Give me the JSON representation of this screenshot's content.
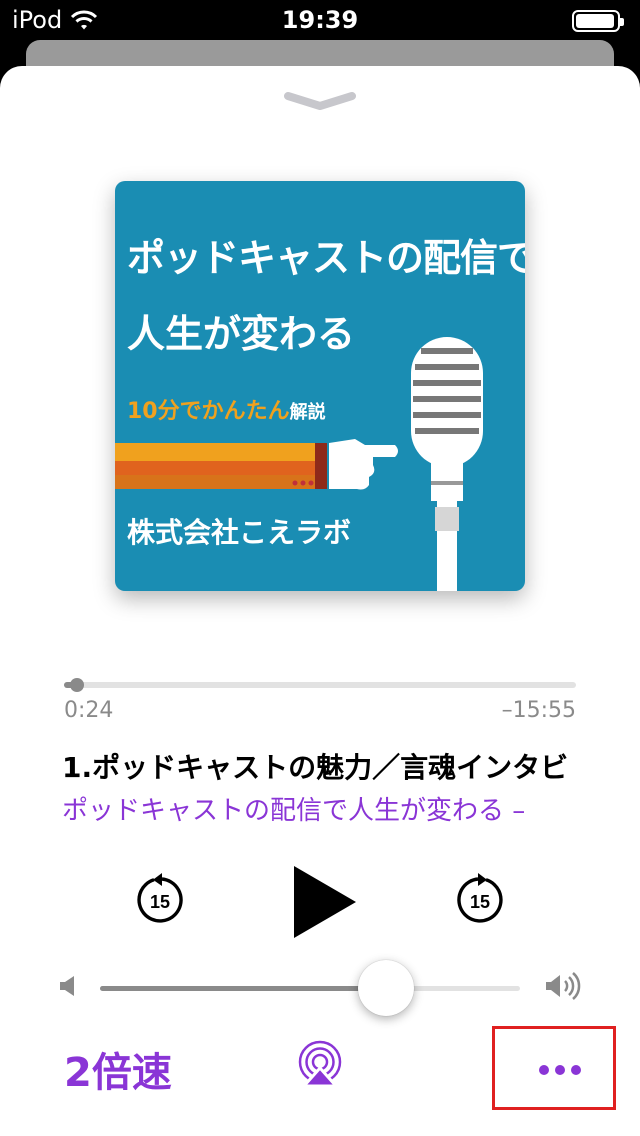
{
  "status_bar": {
    "device": "iPod",
    "time": "19:39"
  },
  "artwork": {
    "title_line1": "ポッドキャストの配信で",
    "title_line2": "人生が変わる",
    "subtitle_part1": "10分で",
    "subtitle_part2": "かんたん",
    "subtitle_part3": "解説",
    "publisher": "株式会社こえラボ",
    "colors": {
      "background": "#1a8db3",
      "accent": "#f0a11e"
    }
  },
  "playback": {
    "elapsed": "0:24",
    "remaining": "–15:55",
    "progress_fraction": 0.025
  },
  "episode": {
    "title": "1.ポッドキャストの魅力／言魂インタビ",
    "show": "ポッドキャストの配信で人生が変わる –"
  },
  "controls": {
    "skip_back_seconds": "15",
    "skip_forward_seconds": "15",
    "volume_fraction": 0.68,
    "speed_label": "2倍速",
    "accent_color": "#8a35d6"
  }
}
